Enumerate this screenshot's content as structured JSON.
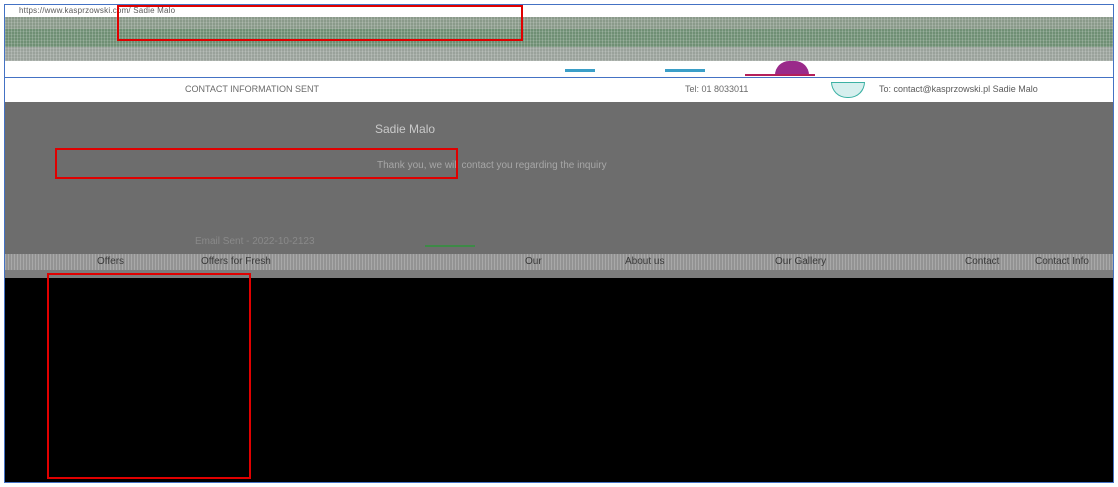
{
  "window": {
    "title_text": "https://www.kasprzowski.com/ Sadie Malo",
    "meta_text": ""
  },
  "chrome": {
    "band1_text": "",
    "band3_text": "",
    "toolbar_left": "",
    "toolbar_right": ""
  },
  "info_bar": {
    "left_text": "CONTACT INFORMATION SENT",
    "phone_text": "Tel: 01 8033011",
    "email_text": "To: contact@kasprzowski.pl Sadie Malo"
  },
  "content": {
    "name": "Sadie Malo",
    "message": "Thank you, we will contact you regarding the inquiry",
    "message_tail": "",
    "footer_text": "Email Sent - 2022-10-2123",
    "footer_mid": ""
  },
  "nav": {
    "items": [
      "Offers",
      "Offers for Fresh",
      "Our",
      "About us",
      "Our Gallery",
      "Contact",
      "Contact Info"
    ]
  },
  "colors": {
    "accent_red": "#e00000",
    "frame_blue": "#4472c4",
    "content_grey": "#6d6d6d",
    "logo_purple": "#9a2a8a"
  },
  "icons": [
    "logo-mark-icon",
    "globe-icon"
  ]
}
